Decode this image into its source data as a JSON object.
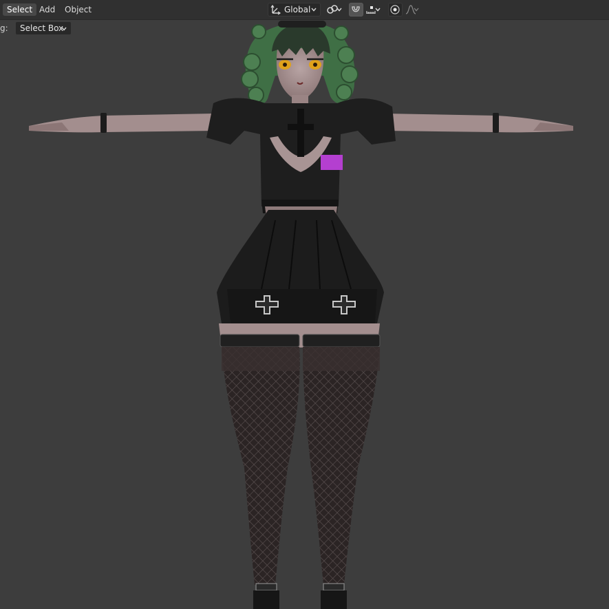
{
  "header": {
    "menu": [
      "Select",
      "Add",
      "Object"
    ],
    "active_menu": "Select",
    "transform_orientation": "Global"
  },
  "tool_settings": {
    "drag_label": "g:",
    "drag_value": "Select Box"
  },
  "icons": {
    "orientation": "axis-gizmo-icon",
    "pivot": "link-icon",
    "snap": "magnet-icon",
    "snap_target": "snap-increment-icon",
    "proportional": "proportional-editing-icon",
    "falloff": "falloff-curve-icon"
  },
  "colors": {
    "header_bg": "#303030",
    "viewport_bg": "#3d3d3d",
    "widget_bg": "#282828",
    "badge_color": "#b43fd0",
    "hair_color": "#3f6f45",
    "eye_color": "#e0a21c"
  }
}
